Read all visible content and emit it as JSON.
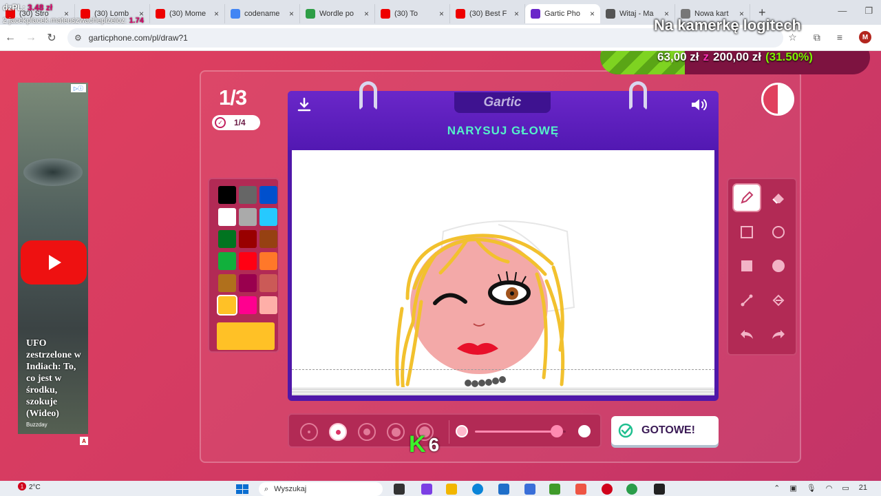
{
  "browser": {
    "tabs": [
      {
        "label": "(30) Stro",
        "icon": "youtube-icon",
        "color": "#e00"
      },
      {
        "label": "(30) Lomb",
        "icon": "youtube-icon",
        "color": "#e00"
      },
      {
        "label": "(30) Mome",
        "icon": "youtube-icon",
        "color": "#e00"
      },
      {
        "label": "codename",
        "icon": "google-icon",
        "color": "#4285f4"
      },
      {
        "label": "Wordle po",
        "icon": "wordle-icon",
        "color": "#2e9e46"
      },
      {
        "label": "(30) To",
        "icon": "youtube-icon",
        "color": "#e00"
      },
      {
        "label": "(30) Best F",
        "icon": "youtube-icon",
        "color": "#e00"
      },
      {
        "label": "Gartic Pho",
        "icon": "gartic-icon",
        "color": "#6a27c9"
      },
      {
        "label": "Witaj - Ma",
        "icon": "mail-icon",
        "color": "#555"
      },
      {
        "label": "Nowa kart",
        "icon": "chrome-icon",
        "color": "#777"
      }
    ],
    "url": "garticphone.com/pl/draw?1",
    "profile_initial": "M"
  },
  "stream_overlay": {
    "top_donation_label": "dzPL:",
    "top_donation_amount": "3.48 zł",
    "sub_text": "2.jacekplacek.mateuszwachepizeloz:",
    "sub_amount": "1.74",
    "camera_text": "Na kamerkę logitech",
    "goal_current": "63,00 zł",
    "goal_sep": "z",
    "goal_target": "200,00 zł",
    "goal_percent": "(31.50%)",
    "goal_fraction": 0.315
  },
  "ad": {
    "headline": "UFO zestrzelone w Indiach: To, co jest w środku, szokuje (Wideo)",
    "brand": "Buzzday",
    "adchoices": "A"
  },
  "game": {
    "round": "1/3",
    "done_count": "1/4",
    "brand": "Gartic",
    "prompt": "NARYSUJ GŁOWĘ",
    "done_button": "GOTOWE!",
    "palette": [
      "#000000",
      "#666666",
      "#0050cd",
      "#ffffff",
      "#aaaaaa",
      "#26c9ff",
      "#017420",
      "#990000",
      "#964112",
      "#11b03c",
      "#ff0013",
      "#ff7829",
      "#b0701c",
      "#99004e",
      "#cb5a57",
      "#ffc126",
      "#ff008f",
      "#feafa8"
    ],
    "selected_color": "#ffc126",
    "tools": [
      "pencil-icon",
      "eraser-icon",
      "rectangle-outline-icon",
      "circle-outline-icon",
      "rectangle-filled-icon",
      "circle-filled-icon",
      "line-icon",
      "bucket-fill-icon",
      "undo-icon",
      "redo-icon"
    ],
    "brush_sizes": 5,
    "selected_brush": 1,
    "opacity_fraction": 0.9
  },
  "stream_badge": {
    "letter": "K",
    "number": "6"
  },
  "taskbar": {
    "weather_temp": "2°C",
    "notifications": "1",
    "search_placeholder": "Wyszukaj",
    "clock": "21"
  }
}
